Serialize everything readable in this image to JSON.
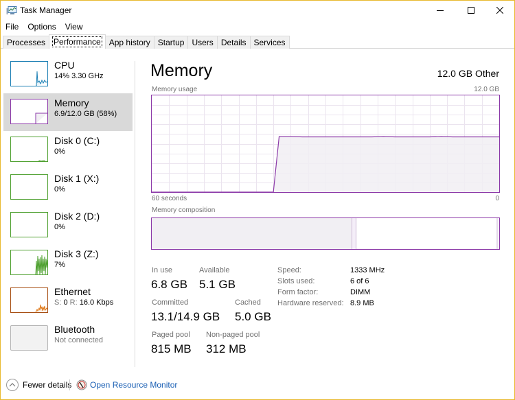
{
  "window": {
    "title": "Task Manager",
    "controls": {
      "minimize": "minimize",
      "maximize": "maximize",
      "close": "close"
    }
  },
  "menu": [
    "File",
    "Options",
    "View"
  ],
  "tabs": [
    {
      "label": "Processes",
      "active": false
    },
    {
      "label": "Performance",
      "active": true
    },
    {
      "label": "App history",
      "active": false
    },
    {
      "label": "Startup",
      "active": false
    },
    {
      "label": "Users",
      "active": false
    },
    {
      "label": "Details",
      "active": false
    },
    {
      "label": "Services",
      "active": false
    }
  ],
  "sidebar": {
    "items": [
      {
        "name": "CPU",
        "sub": "14%  3.30 GHz",
        "color": "#1b7fb4",
        "selected": false
      },
      {
        "name": "Memory",
        "sub": "6.9/12.0 GB (58%)",
        "color": "#8b38a8",
        "selected": true
      },
      {
        "name": "Disk 0 (C:)",
        "sub": "0%",
        "color": "#4ea02f",
        "selected": false
      },
      {
        "name": "Disk 1 (X:)",
        "sub": "0%",
        "color": "#4ea02f",
        "selected": false
      },
      {
        "name": "Disk 2 (D:)",
        "sub": "0%",
        "color": "#4ea02f",
        "selected": false
      },
      {
        "name": "Disk 3 (Z:)",
        "sub": "7%",
        "color": "#4ea02f",
        "selected": false
      },
      {
        "name": "Ethernet",
        "sub_s_label": "S:",
        "sub_s_value": "0",
        "sub_r_label": "R:",
        "sub_r_value": "16.0 Kbps",
        "color": "#a74f13",
        "selected": false
      },
      {
        "name": "Bluetooth",
        "sub": "Not connected",
        "color": "#b5b5b5",
        "selected": false
      }
    ]
  },
  "main": {
    "title": "Memory",
    "capacity_label": "12.0 GB Other",
    "usage_graph": {
      "label": "Memory usage",
      "max_label": "12.0 GB",
      "x_left_label": "60 seconds",
      "x_right_label": "0",
      "line_color": "#8b38a8",
      "fill_color": "#f1eff3"
    },
    "composition": {
      "label": "Memory composition",
      "in_use_fraction": 0.575,
      "modified_fraction": 0.01,
      "standby_fraction": 0.41
    },
    "stats": {
      "in_use": {
        "label": "In use",
        "value": "6.8 GB"
      },
      "available": {
        "label": "Available",
        "value": "5.1 GB"
      },
      "committed": {
        "label": "Committed",
        "value": "13.1/14.9 GB"
      },
      "cached": {
        "label": "Cached",
        "value": "5.0 GB"
      },
      "paged_pool": {
        "label": "Paged pool",
        "value": "815 MB"
      },
      "non_paged_pool": {
        "label": "Non-paged pool",
        "value": "312 MB"
      }
    },
    "details": [
      {
        "label": "Speed:",
        "value": "1333 MHz"
      },
      {
        "label": "Slots used:",
        "value": "6 of 6"
      },
      {
        "label": "Form factor:",
        "value": "DIMM"
      },
      {
        "label": "Hardware reserved:",
        "value": "8.9 MB"
      }
    ]
  },
  "footer": {
    "fewer_details": "Fewer details",
    "resource_monitor": "Open Resource Monitor"
  },
  "chart_data": {
    "type": "area",
    "title": "Memory usage",
    "xlabel": "",
    "ylabel": "",
    "x_range_seconds": [
      60,
      0
    ],
    "ylim": [
      0,
      12.0
    ],
    "y_unit": "GB",
    "x": [
      60,
      40,
      39,
      38,
      36,
      34,
      32,
      30,
      28,
      26,
      24,
      22,
      20,
      18,
      16,
      14,
      12,
      10,
      8,
      6,
      4,
      2,
      0
    ],
    "values": [
      0,
      0,
      0,
      6.9,
      6.9,
      6.85,
      6.85,
      6.85,
      6.85,
      6.85,
      6.85,
      6.85,
      6.9,
      6.85,
      6.85,
      6.85,
      6.85,
      6.9,
      6.85,
      6.85,
      6.85,
      6.85,
      6.85
    ],
    "grid": true
  }
}
